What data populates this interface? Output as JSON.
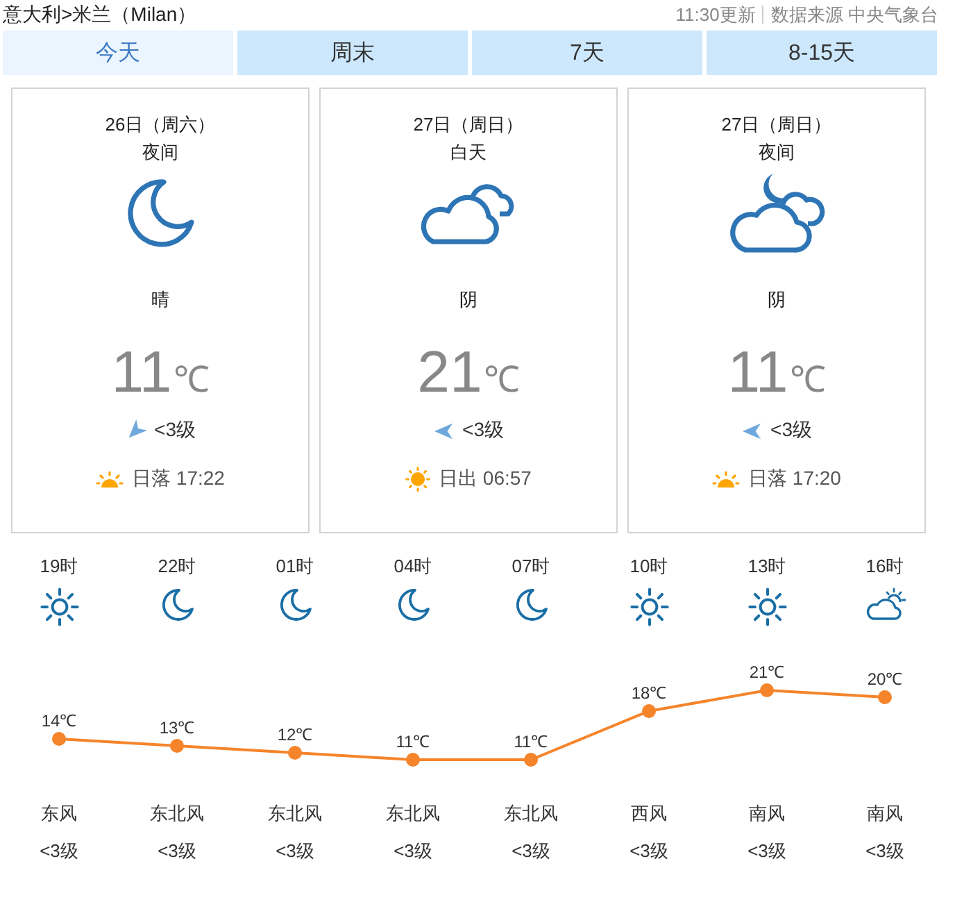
{
  "header": {
    "breadcrumb": "意大利>米兰（Milan）",
    "update_time": "11:30更新",
    "source": "数据来源 中央气象台"
  },
  "tabs": [
    {
      "label": "今天",
      "selected": true
    },
    {
      "label": "周末",
      "selected": false
    },
    {
      "label": "7天",
      "selected": false
    },
    {
      "label": "8-15天",
      "selected": false
    }
  ],
  "cards": [
    {
      "kind": "moon",
      "date": "26日（周六）",
      "period": "夜间",
      "condition": "晴",
      "temperature": "11",
      "unit": "℃",
      "wind": {
        "kind": "southwest",
        "level": "<3级"
      },
      "sun": {
        "kind": "sunset",
        "text": "日落 17:22"
      }
    },
    {
      "kind": "overcast",
      "date": "27日（周日）",
      "period": "白天",
      "condition": "阴",
      "temperature": "21",
      "unit": "℃",
      "wind": {
        "kind": "west",
        "level": "<3级"
      },
      "sun": {
        "kind": "sunrise",
        "text": "日出 06:57"
      }
    },
    {
      "kind": "cloudy-night",
      "date": "27日（周日）",
      "period": "夜间",
      "condition": "阴",
      "temperature": "11",
      "unit": "℃",
      "wind": {
        "kind": "west",
        "level": "<3级"
      },
      "sun": {
        "kind": "sunset",
        "text": "日落 17:20"
      }
    }
  ],
  "hourly": {
    "items": [
      {
        "kind": "sun",
        "time": "19时",
        "wind_direction": "东风",
        "wind_level": "<3级"
      },
      {
        "kind": "moon",
        "time": "22时",
        "wind_direction": "东北风",
        "wind_level": "<3级"
      },
      {
        "kind": "moon",
        "time": "01时",
        "wind_direction": "东北风",
        "wind_level": "<3级"
      },
      {
        "kind": "moon",
        "time": "04时",
        "wind_direction": "东北风",
        "wind_level": "<3级"
      },
      {
        "kind": "moon",
        "time": "07时",
        "wind_direction": "东北风",
        "wind_level": "<3级"
      },
      {
        "kind": "sun",
        "time": "10时",
        "wind_direction": "西风",
        "wind_level": "<3级"
      },
      {
        "kind": "sun",
        "time": "13时",
        "wind_direction": "南风",
        "wind_level": "<3级"
      },
      {
        "kind": "partly-cloudy",
        "time": "16时",
        "wind_direction": "南风",
        "wind_level": "<3级"
      }
    ],
    "chart_data": {
      "type": "line",
      "series": [
        {
          "color": "#f5842a",
          "marker": true,
          "values": [
            14,
            13,
            12,
            11,
            11,
            18,
            21,
            20
          ],
          "value_labels": [
            "14℃",
            "13℃",
            "12℃",
            "11℃",
            "11℃",
            "18℃",
            "21℃",
            "20℃"
          ]
        }
      ],
      "data_labels": true
    }
  }
}
